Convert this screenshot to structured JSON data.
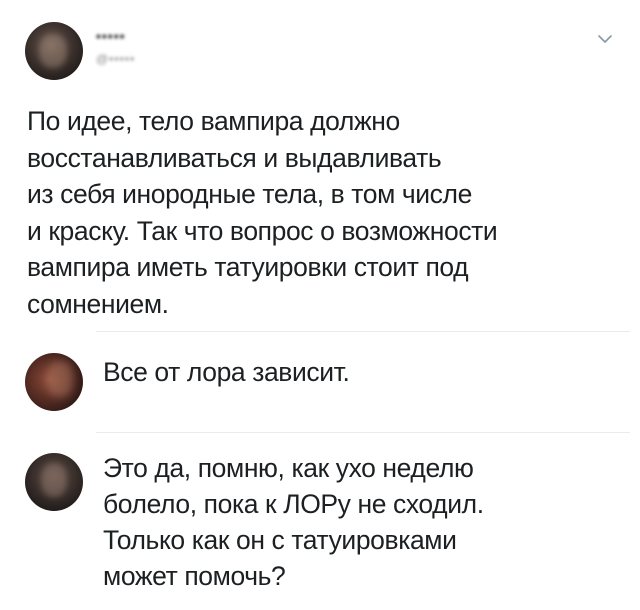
{
  "post": {
    "author_name": "•••••",
    "author_handle": "@•••••",
    "text": "По идее, тело вампира должно\nвосстанавливаться и выдавливать\nиз себя инородные тела, в том числе\nи краску. Так что вопрос о возможности\nвампира иметь татуировки стоит под\nсомнением.",
    "menu_icon": "chevron-down-icon"
  },
  "replies": [
    {
      "text": "Все от лора зависит."
    },
    {
      "text": "Это да, помню, как ухо неделю\nболело, пока к ЛОРу не сходил.\nТолько как он с татуировками\nможет помочь?"
    }
  ],
  "colors": {
    "text": "#1c2022",
    "divider": "#e6ecf0",
    "caret": "#8899a6"
  }
}
